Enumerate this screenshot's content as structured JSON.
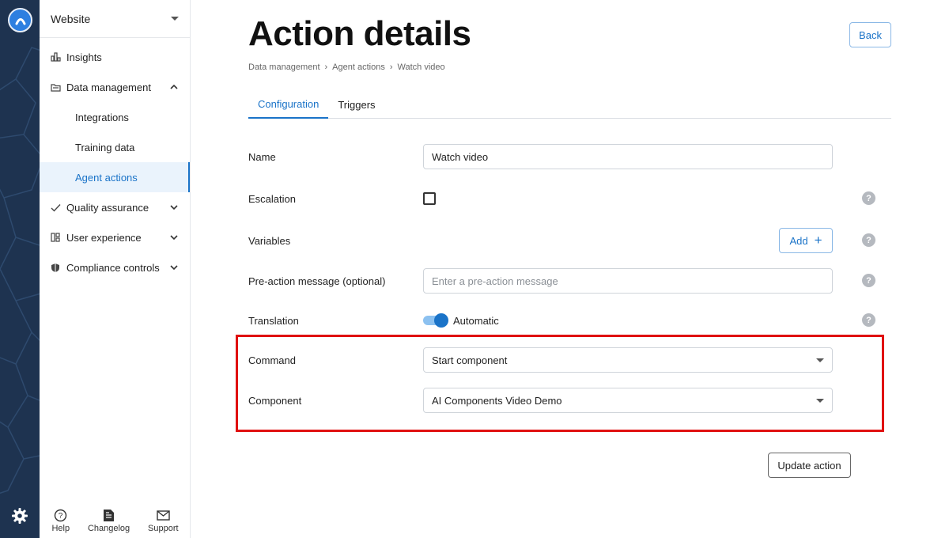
{
  "sidebar": {
    "workspace": "Website",
    "items": [
      {
        "label": "Insights",
        "icon": "chart-icon"
      },
      {
        "label": "Data management",
        "icon": "folder-icon",
        "expanded": true,
        "children": [
          "Integrations",
          "Training data",
          "Agent actions"
        ]
      },
      {
        "label": "Quality assurance",
        "icon": "check-icon"
      },
      {
        "label": "User experience",
        "icon": "layout-icon"
      },
      {
        "label": "Compliance controls",
        "icon": "shield-icon"
      }
    ],
    "active_child": "Agent actions",
    "bottom": {
      "help": "Help",
      "changelog": "Changelog",
      "support": "Support"
    }
  },
  "header": {
    "title": "Action details",
    "back_label": "Back",
    "breadcrumb": [
      "Data management",
      "Agent actions",
      "Watch video"
    ],
    "breadcrumb_sep": "›"
  },
  "tabs": [
    "Configuration",
    "Triggers"
  ],
  "active_tab": "Configuration",
  "form": {
    "name_label": "Name",
    "name_value": "Watch video",
    "escalation_label": "Escalation",
    "escalation_checked": false,
    "variables_label": "Variables",
    "add_label": "Add",
    "add_symbol": "+",
    "pre_action_label": "Pre-action message (optional)",
    "pre_action_placeholder": "Enter a pre-action message",
    "translation_label": "Translation",
    "translation_value": "Automatic",
    "translation_on": true,
    "command_label": "Command",
    "command_value": "Start component",
    "component_label": "Component",
    "component_value": "AI Components Video Demo",
    "help_symbol": "?",
    "update_label": "Update action"
  },
  "colors": {
    "accent": "#1a73c8",
    "rail": "#1e3350",
    "highlight": "#e01010"
  }
}
